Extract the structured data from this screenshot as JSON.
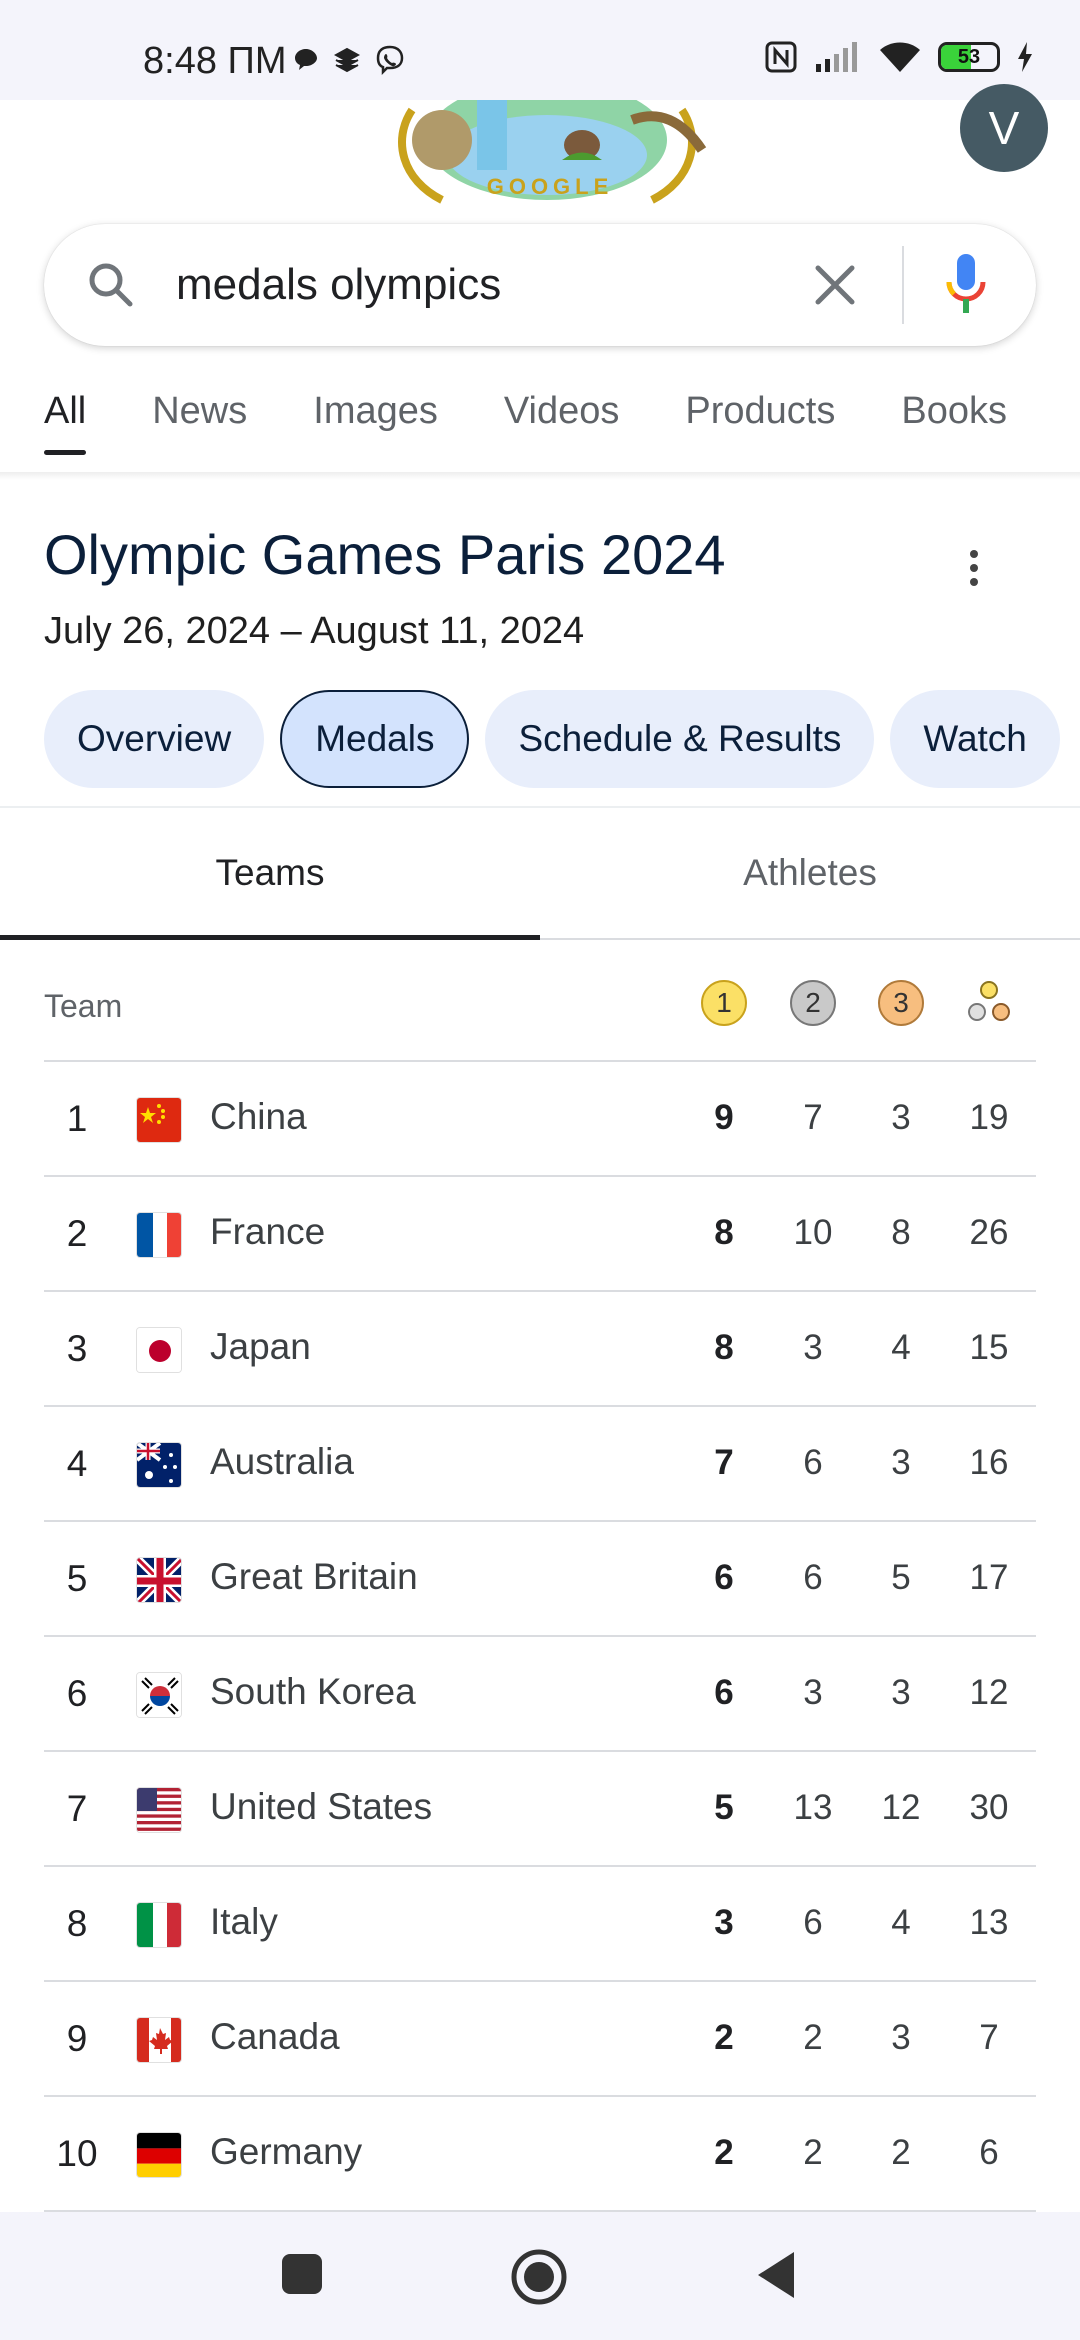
{
  "status_bar": {
    "time": "8:48 ПМ",
    "battery": "53",
    "battery_level": 0.53
  },
  "doodle": {
    "text": "GOOGLE"
  },
  "avatar": {
    "initial": "V"
  },
  "search": {
    "query": "medals olympics"
  },
  "tabs": [
    {
      "label": "All",
      "active": true
    },
    {
      "label": "News"
    },
    {
      "label": "Images"
    },
    {
      "label": "Videos"
    },
    {
      "label": "Products"
    },
    {
      "label": "Books"
    }
  ],
  "event": {
    "title": "Olympic Games Paris 2024",
    "dates": "July 26, 2024 – August 11, 2024"
  },
  "chips": [
    {
      "label": "Overview"
    },
    {
      "label": "Medals",
      "active": true
    },
    {
      "label": "Schedule & Results"
    },
    {
      "label": "Watch"
    }
  ],
  "subtabs": [
    {
      "label": "Teams",
      "active": true
    },
    {
      "label": "Athletes"
    }
  ],
  "table": {
    "team_header": "Team",
    "medal_headers": [
      {
        "symbol": "1",
        "icon": "gold-medal-icon",
        "color": "#fbe066"
      },
      {
        "symbol": "2",
        "icon": "silver-medal-icon",
        "color": "#c9c9c9"
      },
      {
        "symbol": "3",
        "icon": "bronze-medal-icon",
        "color": "#f7be7f"
      },
      {
        "symbol": "",
        "icon": "total-medals-icon"
      }
    ],
    "rows": [
      {
        "rank": "1",
        "country": "China",
        "flag": "china-flag-icon",
        "gold": "9",
        "silver": "7",
        "bronze": "3",
        "total": "19"
      },
      {
        "rank": "2",
        "country": "France",
        "flag": "france-flag-icon",
        "gold": "8",
        "silver": "10",
        "bronze": "8",
        "total": "26"
      },
      {
        "rank": "3",
        "country": "Japan",
        "flag": "japan-flag-icon",
        "gold": "8",
        "silver": "3",
        "bronze": "4",
        "total": "15"
      },
      {
        "rank": "4",
        "country": "Australia",
        "flag": "australia-flag-icon",
        "gold": "7",
        "silver": "6",
        "bronze": "3",
        "total": "16"
      },
      {
        "rank": "5",
        "country": "Great Britain",
        "flag": "great-britain-flag-icon",
        "gold": "6",
        "silver": "6",
        "bronze": "5",
        "total": "17"
      },
      {
        "rank": "6",
        "country": "South Korea",
        "flag": "south-korea-flag-icon",
        "gold": "6",
        "silver": "3",
        "bronze": "3",
        "total": "12"
      },
      {
        "rank": "7",
        "country": "United States",
        "flag": "united-states-flag-icon",
        "gold": "5",
        "silver": "13",
        "bronze": "12",
        "total": "30"
      },
      {
        "rank": "8",
        "country": "Italy",
        "flag": "italy-flag-icon",
        "gold": "3",
        "silver": "6",
        "bronze": "4",
        "total": "13"
      },
      {
        "rank": "9",
        "country": "Canada",
        "flag": "canada-flag-icon",
        "gold": "2",
        "silver": "2",
        "bronze": "3",
        "total": "7"
      },
      {
        "rank": "10",
        "country": "Germany",
        "flag": "germany-flag-icon",
        "gold": "2",
        "silver": "2",
        "bronze": "2",
        "total": "6"
      }
    ]
  },
  "nav_bar": {
    "buttons": [
      "recents-button",
      "home-button",
      "back-button"
    ]
  }
}
